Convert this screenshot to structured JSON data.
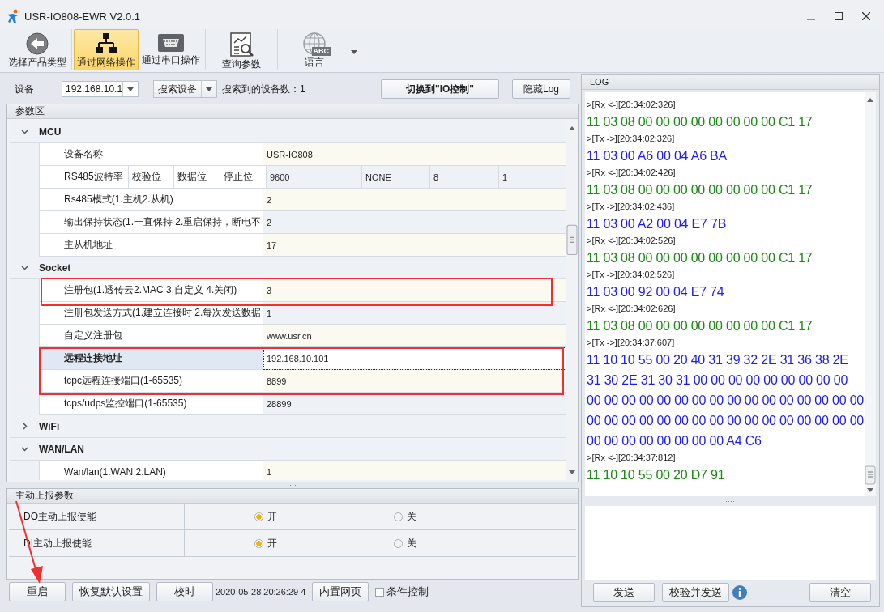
{
  "window": {
    "title": "USR-IO808-EWR V2.0.1"
  },
  "toolbar": [
    {
      "label": "选择产品类型",
      "selected": false
    },
    {
      "label": "通过网络操作",
      "selected": true
    },
    {
      "label": "通过串口操作",
      "selected": false
    },
    {
      "label": "查询参数",
      "selected": false
    },
    {
      "label": "语言",
      "badge": "ABC",
      "selected": false
    }
  ],
  "device_bar": {
    "device_label": "设备",
    "device_value": "192.168.10.1",
    "search_button": "搜索设备",
    "found_label": "搜索到的设备数：",
    "found_count": "1",
    "switch_button": "切换到\"IO控制\"",
    "hide_log_button": "隐藏Log"
  },
  "params": {
    "title": "参数区",
    "categories": [
      {
        "name": "MCU",
        "expanded": true,
        "rows": [
          {
            "kind": "single",
            "label": "设备名称",
            "value": "USR-IO808",
            "selected": false
          },
          {
            "kind": "multi",
            "labels": [
              "RS485波特率",
              "校验位",
              "数据位",
              "停止位"
            ],
            "values": [
              "9600",
              "NONE",
              "8",
              "1"
            ],
            "selected": false
          },
          {
            "kind": "single",
            "label": "Rs485模式(1.主机2.从机)",
            "value": "2",
            "selected": false
          },
          {
            "kind": "single",
            "label": "输出保持状态(1.一直保持 2.重启保持，断电不",
            "value": "2",
            "selected": false
          },
          {
            "kind": "single",
            "label": "主从机地址",
            "value": "17",
            "selected": false
          }
        ]
      },
      {
        "name": "Socket",
        "expanded": true,
        "rows": [
          {
            "kind": "single",
            "label": "注册包(1.透传云2.MAC 3.自定义 4.关闭)",
            "value": "3",
            "selected": false
          },
          {
            "kind": "single",
            "label": "注册包发送方式(1.建立连接时 2.每次发送数据",
            "value": "1",
            "selected": false
          },
          {
            "kind": "single",
            "label": "自定义注册包",
            "value": "www.usr.cn",
            "selected": false
          },
          {
            "kind": "single",
            "label": "远程连接地址",
            "value": "192.168.10.101",
            "selected": true
          },
          {
            "kind": "single",
            "label": "tcpc远程连接端口(1-65535)",
            "value": "8899",
            "selected": false
          },
          {
            "kind": "single",
            "label": "tcps/udps监控端口(1-65535)",
            "value": "28899",
            "selected": false
          }
        ]
      },
      {
        "name": "WiFi",
        "expanded": false
      },
      {
        "name": "WAN/LAN",
        "expanded": true,
        "rows": [
          {
            "kind": "single",
            "label": "Wan/lan(1.WAN 2.LAN)",
            "value": "1",
            "selected": false
          }
        ]
      }
    ]
  },
  "report": {
    "title": "主动上报参数",
    "rows": [
      {
        "label": "DO主动上报使能",
        "options": [
          {
            "label": "开",
            "selected": true
          },
          {
            "label": "关",
            "selected": false
          }
        ]
      },
      {
        "label": "DI主动上报使能",
        "options": [
          {
            "label": "开",
            "selected": true
          },
          {
            "label": "关",
            "selected": false
          }
        ]
      }
    ]
  },
  "bottom_bar": [
    {
      "kind": "button",
      "label": "重启"
    },
    {
      "kind": "button",
      "label": "恢复默认设置"
    },
    {
      "kind": "button",
      "label": "校时"
    },
    {
      "kind": "text",
      "label": "2020-05-28 20:26:29 4"
    },
    {
      "kind": "button",
      "label": "内置网页"
    },
    {
      "kind": "checkbox",
      "label": "条件控制",
      "checked": false
    }
  ],
  "log": {
    "title": "LOG",
    "entries": [
      {
        "kind": "rx",
        "header": ">[Rx <-][20:34:02:326]",
        "data": "11 03 08 00 00 00 00 00 00 00 00 C1 17"
      },
      {
        "kind": "tx",
        "header": ">[Tx ->][20:34:02:326]",
        "data": "11 03 00 A6 00 04 A6 BA"
      },
      {
        "kind": "rx",
        "header": ">[Rx <-][20:34:02:426]",
        "data": "11 03 08 00 00 00 00 00 00 00 00 C1 17"
      },
      {
        "kind": "tx",
        "header": ">[Tx ->][20:34:02:436]",
        "data": "11 03 00 A2 00 04 E7 7B"
      },
      {
        "kind": "rx",
        "header": ">[Rx <-][20:34:02:526]",
        "data": "11 03 08 00 00 00 00 00 00 00 00 C1 17"
      },
      {
        "kind": "tx",
        "header": ">[Tx ->][20:34:02:526]",
        "data": "11 03 00 92 00 04 E7 74"
      },
      {
        "kind": "rx",
        "header": ">[Rx <-][20:34:02:626]",
        "data": "11 03 08 00 00 00 00 00 00 00 00 C1 17"
      },
      {
        "kind": "tx",
        "header": ">[Tx ->][20:34:37:607]",
        "data": "11 10 10 55 00 20 40 31 39 32 2E 31 36 38 2E 31 30 2E 31 30 31 00 00 00 00 00 00 00 00 00 00 00 00 00 00 00 00 00 00 00 00 00 00 00 00 00 00 00 00 00 00 00 00 00 00 00 00 00 00 00 00 00 00 00 00 00 00 00 00 00 A4 C6"
      },
      {
        "kind": "rx",
        "header": ">[Rx <-][20:34:37:812]",
        "data": "11 10 10 55 00 20 D7 91"
      }
    ],
    "actions": [
      {
        "kind": "button",
        "label": "发送"
      },
      {
        "kind": "button",
        "label": "校验并发送"
      },
      {
        "kind": "info"
      },
      {
        "kind": "button",
        "label": "清空"
      }
    ]
  }
}
